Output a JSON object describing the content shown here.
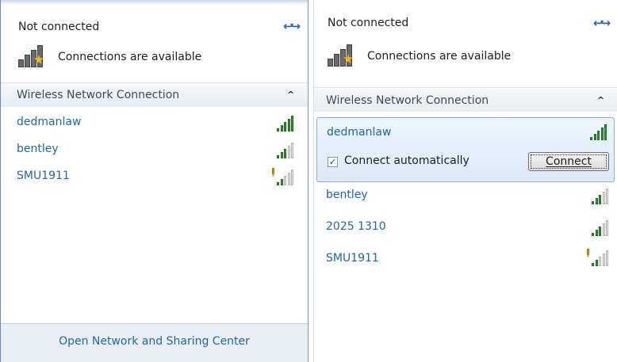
{
  "left_panel": {
    "status_title": "Not connected",
    "availability": "Connections are available",
    "section_label": "Wireless Network Connection",
    "networks": [
      {
        "name": "dedmanlaw",
        "signal": 5,
        "secured": true
      },
      {
        "name": "bentley",
        "signal": 3,
        "secured": true
      },
      {
        "name": "SMU1911",
        "signal": 2,
        "secured": false
      }
    ],
    "footer_link": "Open Network and Sharing Center"
  },
  "right_panel": {
    "status_title": "Not connected",
    "availability": "Connections are available",
    "section_label": "Wireless Network Connection",
    "selected_network": {
      "name": "dedmanlaw",
      "signal": 5,
      "connect_automatically_label": "Connect automatically",
      "connect_automatically_checked": true,
      "connect_button_label": "Connect"
    },
    "networks": [
      {
        "name": "bentley",
        "signal": 3,
        "secured": true
      },
      {
        "name": "2025 1310",
        "signal": 3,
        "secured": true
      },
      {
        "name": "SMU1911",
        "signal": 2,
        "secured": false
      }
    ]
  },
  "icons": {
    "refresh": "refresh-icon",
    "network_status": "network-bars-with-star-icon",
    "collapse": "chevron-up-icon",
    "signal": "signal-strength-icon",
    "warning_shield": "unsecured-shield-icon"
  },
  "colors": {
    "link_blue": "#1f66a8",
    "signal_green": "#2e9a2e",
    "selection_border": "#86b1dd"
  }
}
